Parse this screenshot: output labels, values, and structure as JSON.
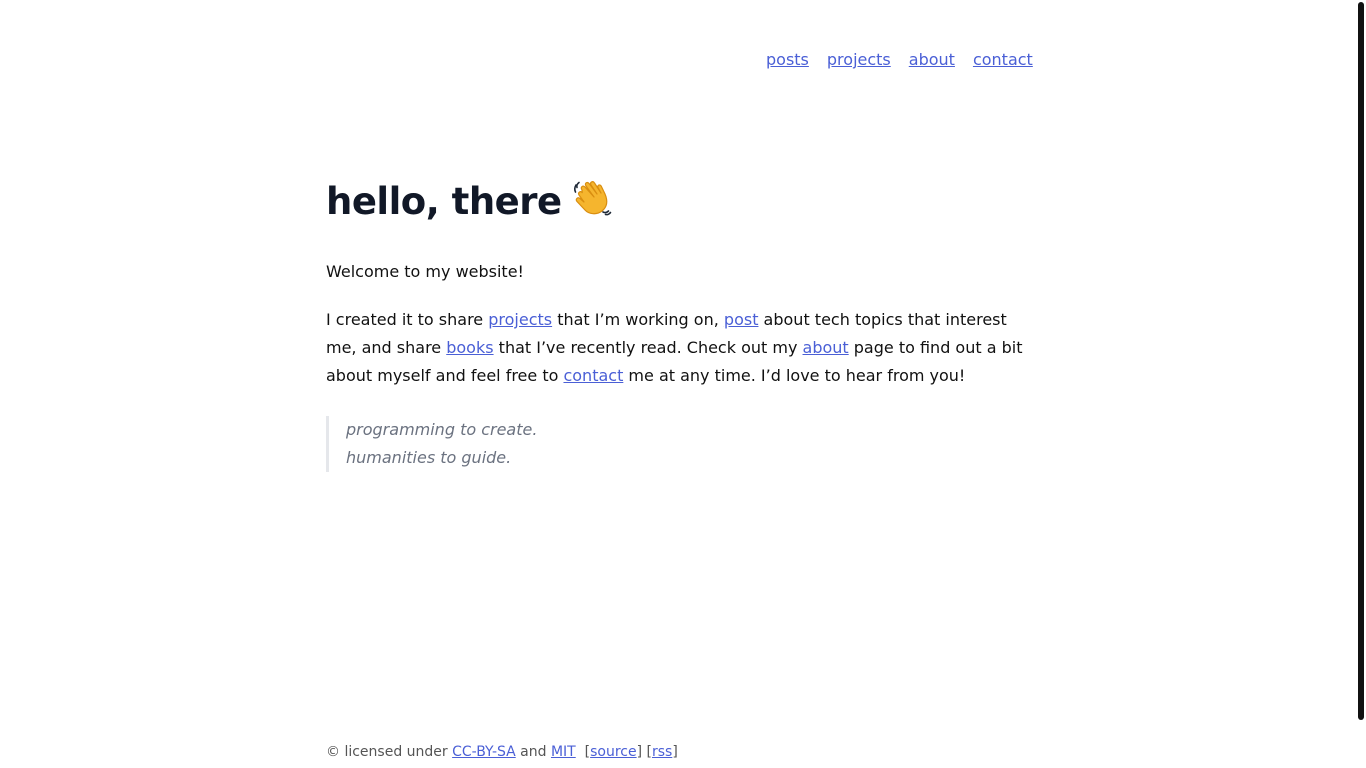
{
  "nav": {
    "posts": "posts",
    "projects": "projects",
    "about": "about",
    "contact": "contact"
  },
  "heading": {
    "text": "hello, there",
    "emoji_icon": "waving-hand-icon"
  },
  "welcome": "Welcome to my website!",
  "intro": {
    "t1": "I created it to share ",
    "link_projects": "projects",
    "t2": " that I’m working on, ",
    "link_post": "post",
    "t3": " about tech topics that interest me, and share ",
    "link_books": "books",
    "t4": " that I’ve recently read. Check out my ",
    "link_about": "about",
    "t5": " page to find out a bit about myself and feel free to ",
    "link_contact": "contact",
    "t6": " me at any time. I’d love to hear from you!"
  },
  "quote": {
    "line1": "programming to create.",
    "line2": "humanities to guide."
  },
  "footer": {
    "prefix": "© licensed under ",
    "link_ccbysa": "CC-BY-SA",
    "and": " and ",
    "link_mit": "MIT",
    "bracket_open1": "  [",
    "link_source": "source",
    "bracket_mid": "] [",
    "link_rss": "rss",
    "bracket_close": "]"
  },
  "colors": {
    "link": "#4a5fd6",
    "heading": "#111827",
    "quote_text": "#6b7280",
    "quote_border": "#e5e7eb"
  }
}
